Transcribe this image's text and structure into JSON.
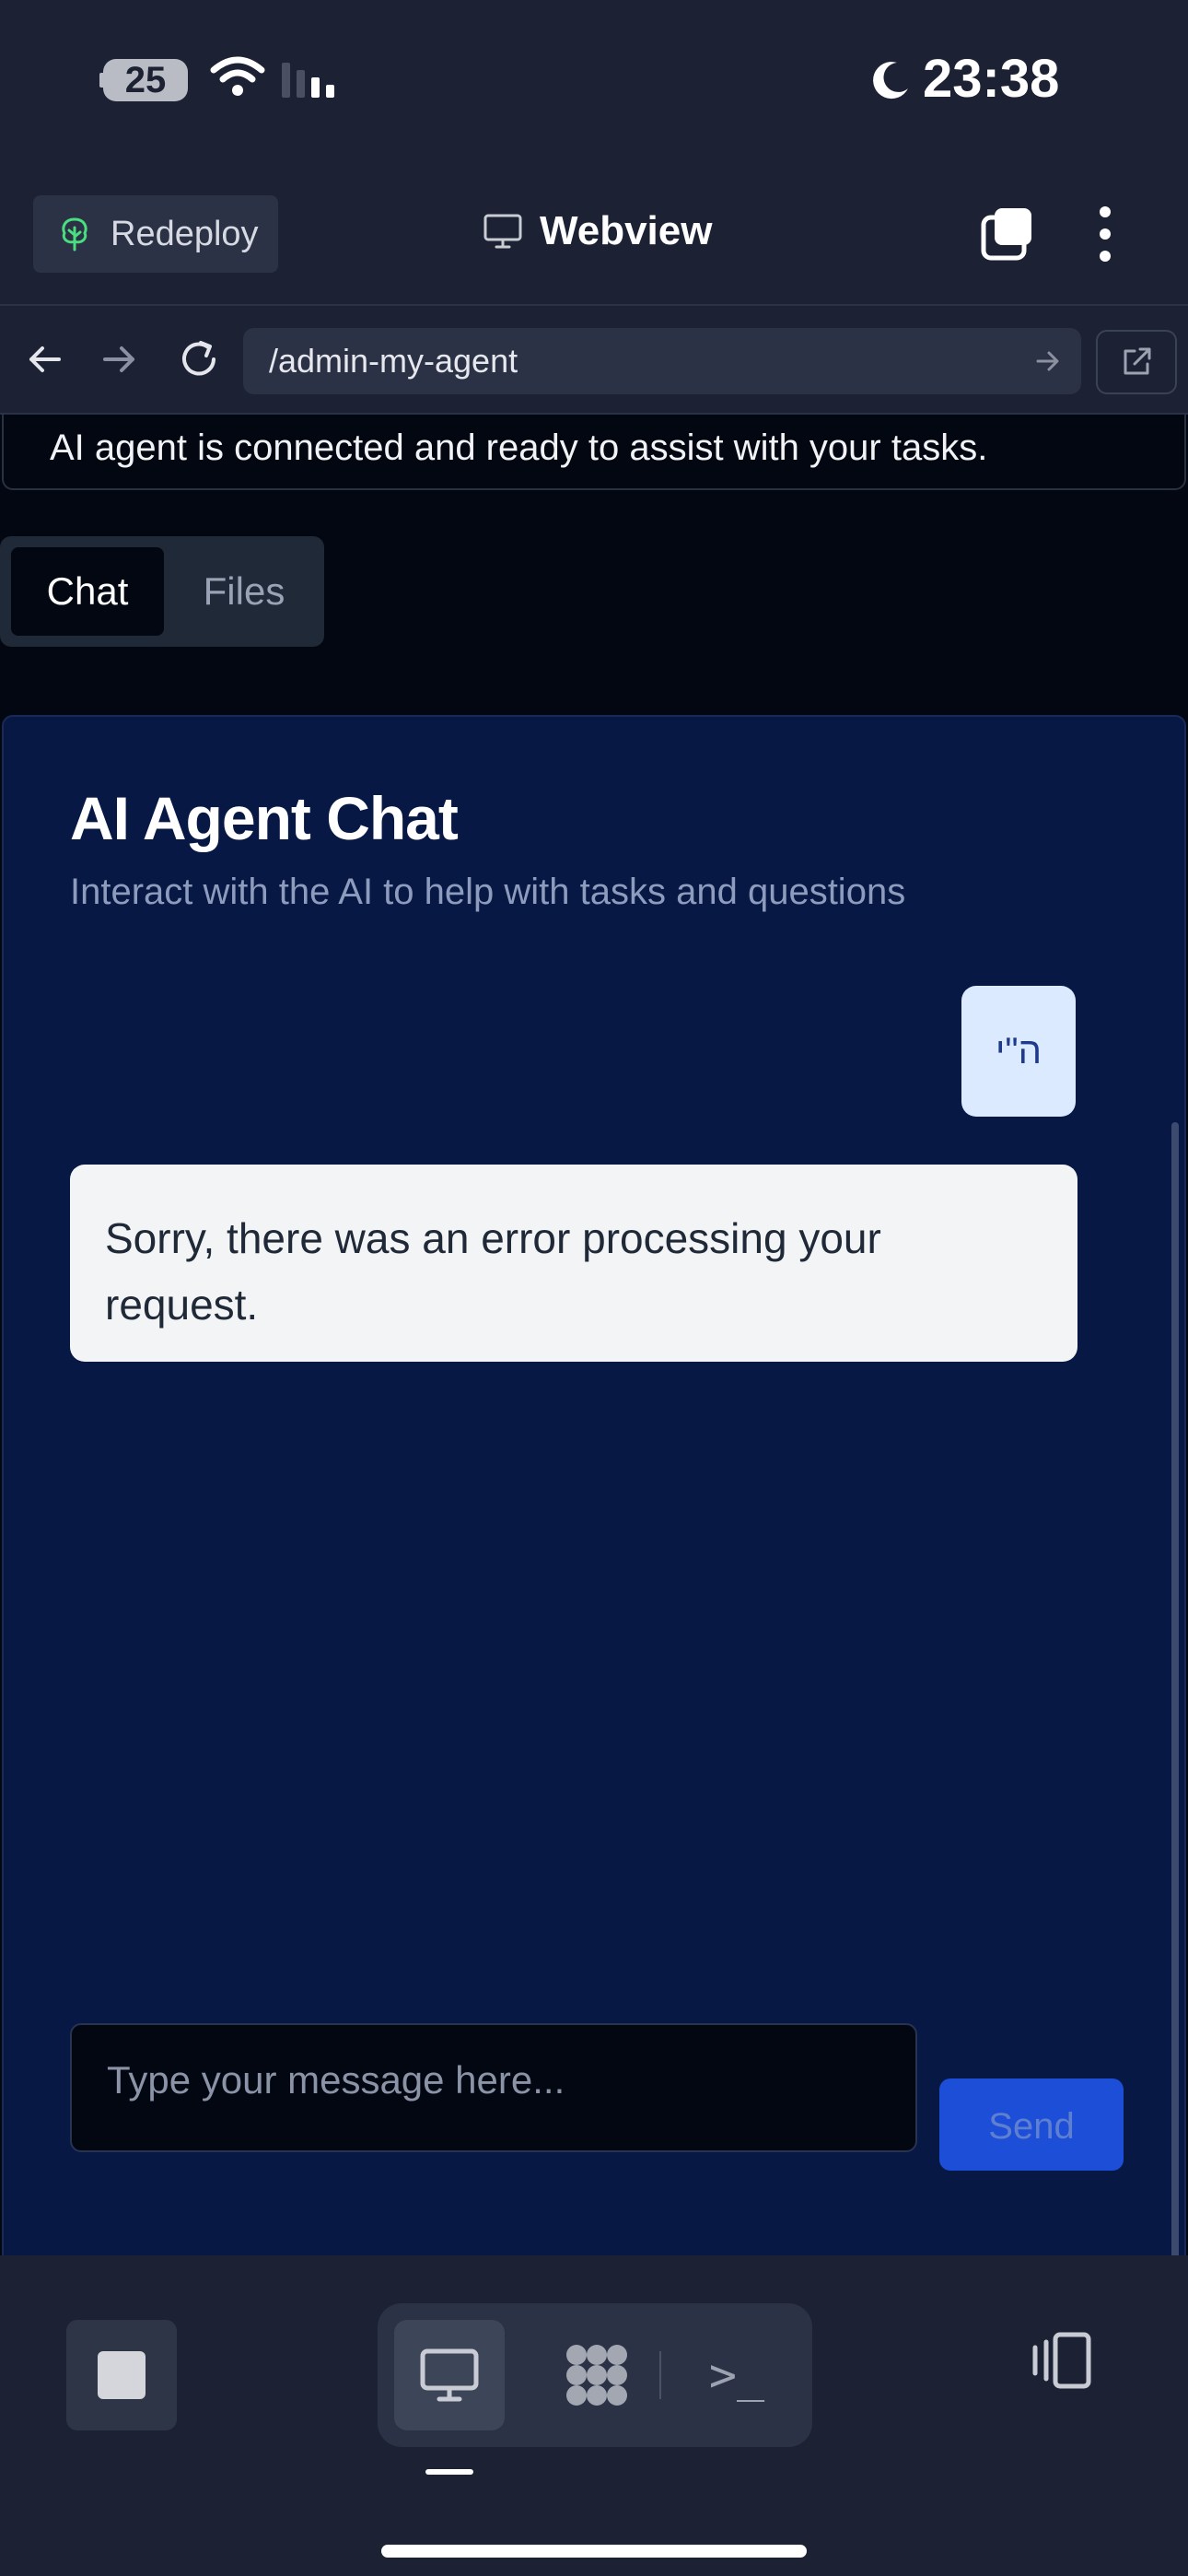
{
  "status_bar": {
    "battery_level": "25",
    "time": "23:38"
  },
  "header": {
    "redeploy_label": "Redeploy",
    "title": "Webview"
  },
  "browser": {
    "url": "/admin-my-agent"
  },
  "page": {
    "connected_text": "AI agent is connected and ready to assist with your tasks.",
    "tabs": [
      {
        "label": "Chat",
        "active": true
      },
      {
        "label": "Files",
        "active": false
      }
    ],
    "chat": {
      "title": "AI Agent Chat",
      "subtitle": "Interact with the AI to help with tasks and questions",
      "messages": [
        {
          "role": "user",
          "text": "ה\"י"
        },
        {
          "role": "assistant",
          "text": "Sorry, there was an error processing your request."
        }
      ],
      "input_placeholder": "Type your message here...",
      "send_label": "Send"
    }
  },
  "bottom_toolbar": {
    "terminal_glyph": ">_"
  },
  "colors": {
    "app_bg": "#1c2233",
    "content_bg": "#030712",
    "chat_card_bg": "#071845",
    "user_bubble": "#dbeafe",
    "assistant_bubble": "#f3f4f6",
    "accent": "#1d4ed8"
  }
}
